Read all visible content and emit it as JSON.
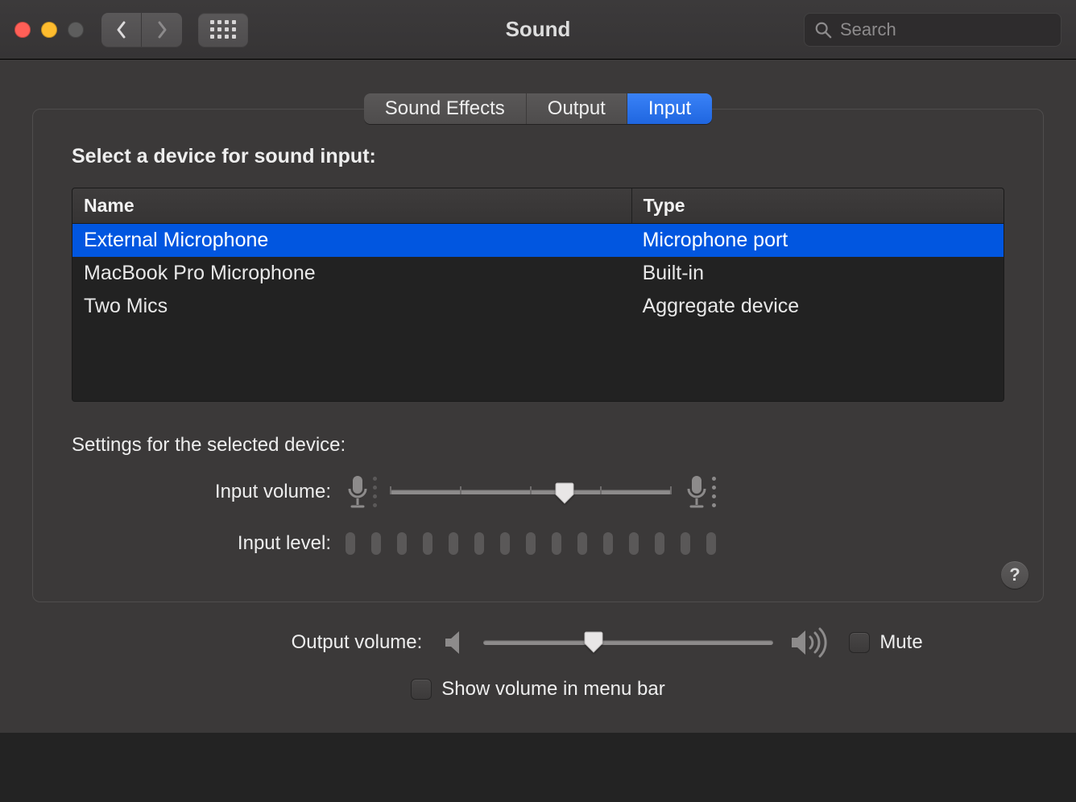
{
  "window": {
    "title": "Sound"
  },
  "search": {
    "placeholder": "Search",
    "value": ""
  },
  "tabs": {
    "sound_effects": "Sound Effects",
    "output": "Output",
    "input": "Input",
    "active_index": 2
  },
  "input_panel": {
    "heading": "Select a device for sound input:",
    "columns": {
      "name": "Name",
      "type": "Type"
    },
    "devices": [
      {
        "name": "External Microphone",
        "type": "Microphone port",
        "selected": true
      },
      {
        "name": "MacBook Pro Microphone",
        "type": "Built-in",
        "selected": false
      },
      {
        "name": "Two Mics",
        "type": "Aggregate device",
        "selected": false
      }
    ],
    "settings_heading": "Settings for the selected device:",
    "input_volume_label": "Input volume:",
    "input_volume_percent": 62,
    "input_level_label": "Input level:",
    "input_level_segments": 15,
    "input_level_active": 0
  },
  "output": {
    "label": "Output volume:",
    "percent": 38,
    "mute_label": "Mute",
    "mute_checked": false,
    "show_menu_label": "Show volume in menu bar",
    "show_menu_checked": false
  },
  "icons": {
    "close": "close-icon",
    "minimize": "minimize-icon",
    "zoom": "zoom-icon",
    "back": "chevron-left-icon",
    "forward": "chevron-right-icon",
    "grid": "grid-icon",
    "search": "search-icon",
    "mic_low": "mic-low-icon",
    "mic_high": "mic-high-icon",
    "speaker_low": "speaker-low-icon",
    "speaker_high": "speaker-high-icon",
    "help": "help-icon"
  },
  "colors": {
    "accent": "#1f66e0",
    "selection": "#0156e0",
    "panel_border": "#4f4d4d",
    "background": "#3b3939"
  }
}
